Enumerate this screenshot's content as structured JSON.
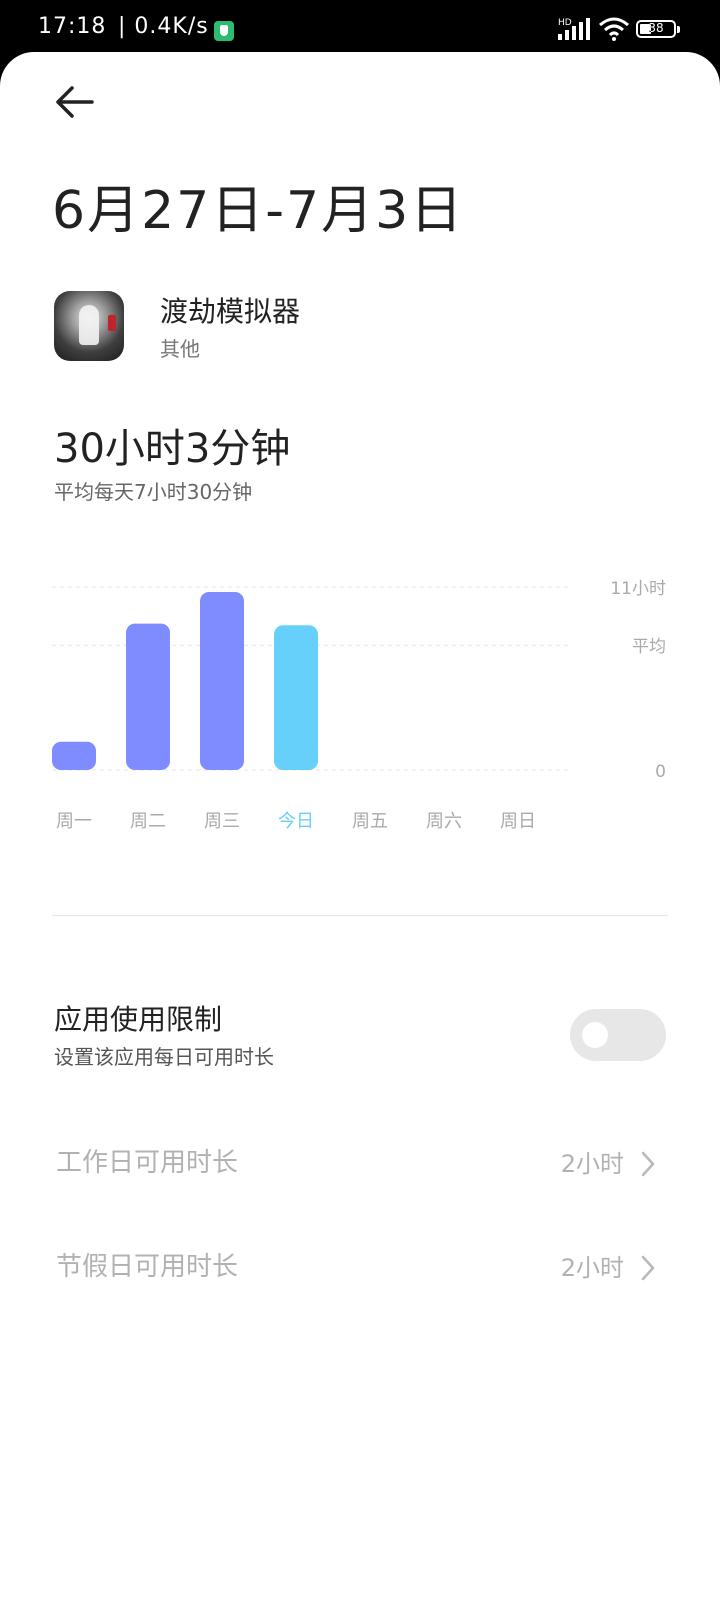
{
  "status_bar": {
    "time": "17:18",
    "network_speed": "| 0.4K/s",
    "signal_label": "HD",
    "battery_level": "38"
  },
  "header": {
    "date_range": "6月27日-7月3日"
  },
  "app": {
    "name": "渡劫模拟器",
    "category": "其他"
  },
  "usage": {
    "total": "30小时3分钟",
    "daily_average": "平均每天7小时30分钟"
  },
  "chart_data": {
    "type": "bar",
    "categories": [
      "周一",
      "周二",
      "周三",
      "今日",
      "周五",
      "周六",
      "周日"
    ],
    "values": [
      1.7,
      8.8,
      10.7,
      8.7,
      0,
      0,
      0
    ],
    "highlight_index": 3,
    "ylim": [
      0,
      11
    ],
    "y_ticks": [
      {
        "value": 11,
        "label": "11小时"
      },
      {
        "value": 7.5,
        "label": "平均"
      },
      {
        "value": 0,
        "label": "0"
      }
    ],
    "colors": {
      "bar": "#7f8cff",
      "today": "#66d0fb",
      "axis_label": "#aaaaaa",
      "today_label": "#66d0fb",
      "grid": "#e4e4e4"
    }
  },
  "limits": {
    "title": "应用使用限制",
    "subtitle": "设置该应用每日可用时长",
    "enabled": false,
    "workday_label": "工作日可用时长",
    "workday_value": "2小时",
    "holiday_label": "节假日可用时长",
    "holiday_value": "2小时"
  }
}
